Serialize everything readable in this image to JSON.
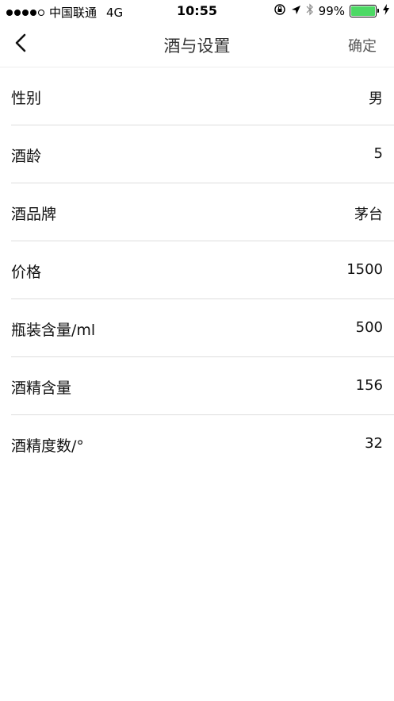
{
  "status_bar": {
    "carrier": "中国联通",
    "network": "4G",
    "time": "10:55",
    "battery_percent_text": "99%",
    "battery_level": 0.99,
    "battery_color": "#4cd964"
  },
  "nav": {
    "back_icon": "chevron-left-icon",
    "title": "酒与设置",
    "confirm_label": "确定"
  },
  "rows": [
    {
      "label": "性别",
      "value": "男"
    },
    {
      "label": "酒龄",
      "value": "5"
    },
    {
      "label": "酒品牌",
      "value": "茅台"
    },
    {
      "label": "价格",
      "value": "1500"
    },
    {
      "label": "瓶装含量/ml",
      "value": "500"
    },
    {
      "label": "酒精含量",
      "value": "156"
    },
    {
      "label": "酒精度数/°",
      "value": "32"
    }
  ]
}
